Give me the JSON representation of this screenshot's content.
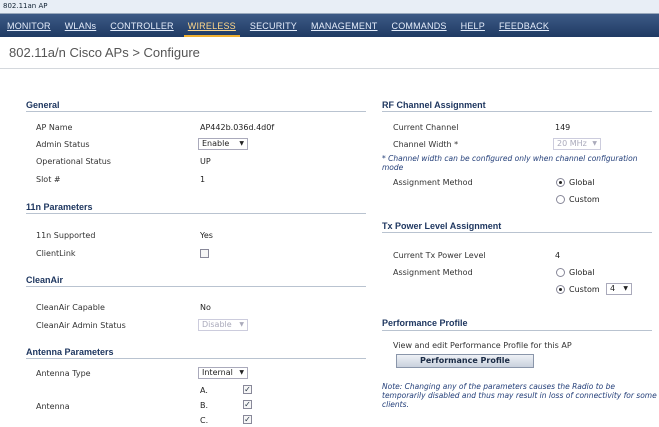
{
  "window": {
    "title": "802.11an AP"
  },
  "menu": {
    "items": [
      "MONITOR",
      "WLANs",
      "CONTROLLER",
      "WIRELESS",
      "SECURITY",
      "MANAGEMENT",
      "COMMANDS",
      "HELP",
      "FEEDBACK"
    ],
    "active": "WIRELESS"
  },
  "page": {
    "title": "802.11a/n Cisco APs > Configure"
  },
  "general": {
    "header": "General",
    "ap_name_label": "AP Name",
    "ap_name_value": "AP442b.036d.4d0f",
    "admin_status_label": "Admin Status",
    "admin_status_value": "Enable",
    "oper_status_label": "Operational Status",
    "oper_status_value": "UP",
    "slot_label": "Slot #",
    "slot_value": "1"
  },
  "n11": {
    "header": "11n Parameters",
    "supported_label": "11n Supported",
    "supported_value": "Yes",
    "clientlink_label": "ClientLink"
  },
  "cleanair": {
    "header": "CleanAir",
    "capable_label": "CleanAir Capable",
    "capable_value": "No",
    "admin_label": "CleanAir Admin Status",
    "admin_value": "Disable"
  },
  "antenna": {
    "header": "Antenna Parameters",
    "type_label": "Antenna Type",
    "type_value": "Internal",
    "antenna_label": "Antenna",
    "a_label": "A.",
    "b_label": "B.",
    "c_label": "C."
  },
  "rf": {
    "header": "RF Channel Assignment",
    "current_label": "Current Channel",
    "current_value": "149",
    "width_label": "Channel Width *",
    "width_value": "20 MHz",
    "note": "* Channel width can be configured only when channel configuration mode",
    "assign_label": "Assignment Method",
    "global_label": "Global",
    "custom_label": "Custom"
  },
  "tx": {
    "header": "Tx Power Level Assignment",
    "current_label": "Current Tx Power Level",
    "current_value": "4",
    "assign_label": "Assignment Method",
    "global_label": "Global",
    "custom_label": "Custom",
    "custom_value": "4"
  },
  "perf": {
    "header": "Performance Profile",
    "desc": "View and edit Performance Profile for this AP",
    "button": "Performance Profile",
    "note": "Note: Changing any of the parameters causes the Radio to be temporarily disabled and thus may result in loss of connectivity for some clients."
  }
}
